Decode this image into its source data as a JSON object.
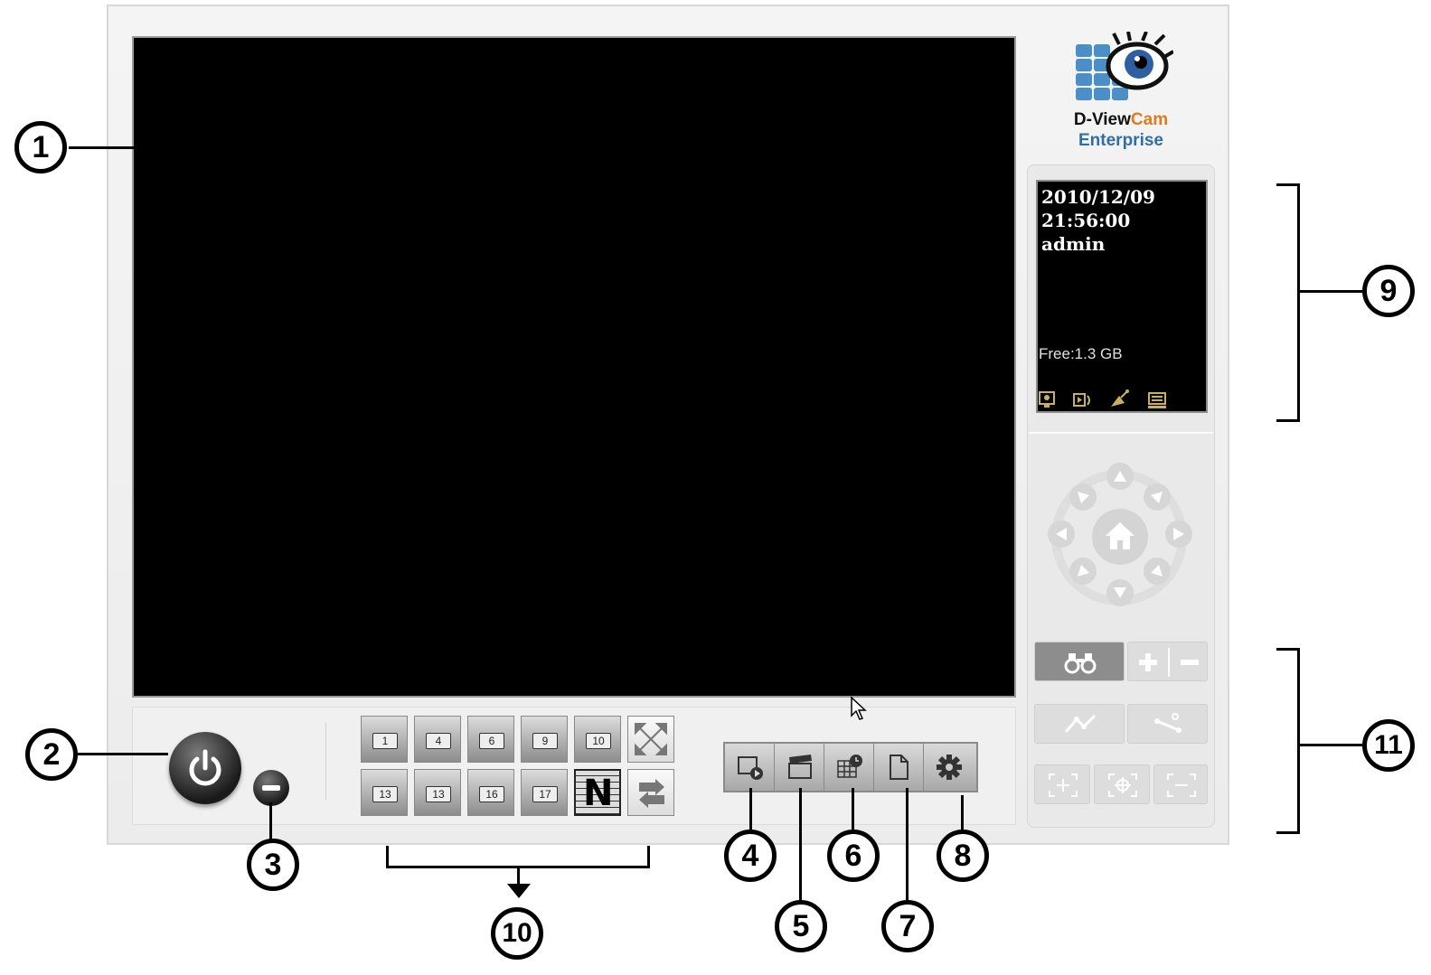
{
  "app": {
    "logo_line1": "D-View",
    "logo_line1_accent": "Cam",
    "logo_line2": "Enterprise"
  },
  "info_panel": {
    "date": "2010/12/09",
    "time": "21:56:00",
    "user": "admin",
    "free_space": "Free:1.3 GB"
  },
  "layout_buttons": {
    "row1": [
      "1",
      "4",
      "6",
      "9",
      "10"
    ],
    "row2": [
      "13",
      "13",
      "16",
      "17",
      "N"
    ]
  },
  "callouts": [
    "1",
    "2",
    "3",
    "4",
    "5",
    "6",
    "7",
    "8",
    "9",
    "10",
    "11"
  ],
  "colors": {
    "video_bg": "#000000",
    "logo_accent": "#e07b20",
    "logo_blue": "#2f6fa8"
  }
}
